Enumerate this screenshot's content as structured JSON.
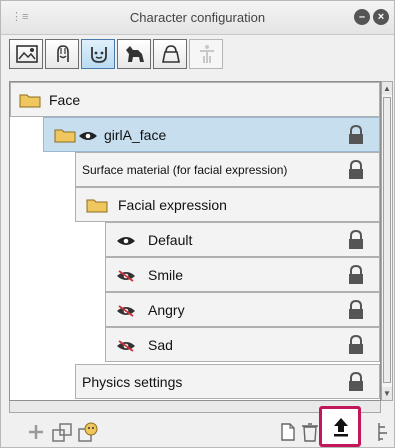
{
  "panel": {
    "title": "Character configuration",
    "title_icons": [
      "minimize-icon",
      "close-icon"
    ]
  },
  "tabs": [
    {
      "icon": "image-icon",
      "state": "normal"
    },
    {
      "icon": "hair-icon",
      "state": "normal"
    },
    {
      "icon": "face-icon",
      "state": "active"
    },
    {
      "icon": "animal-icon",
      "state": "normal"
    },
    {
      "icon": "bag-icon",
      "state": "normal"
    },
    {
      "icon": "figure-icon",
      "state": "disabled"
    }
  ],
  "tree": {
    "items": [
      {
        "label": "Face",
        "icon": "folder-icon",
        "selected": false
      },
      {
        "label": "girlA_face",
        "icon": "folder-icon",
        "visibility": "visible",
        "locked": true,
        "selected": true
      },
      {
        "label": "Surface material (for facial expression)",
        "locked": true,
        "selected": false
      },
      {
        "label": "Facial expression",
        "icon": "folder-icon",
        "selected": false
      },
      {
        "label": "Default",
        "visibility": "visible",
        "locked": true,
        "selected": false
      },
      {
        "label": "Smile",
        "visibility": "hidden",
        "locked": true,
        "selected": false
      },
      {
        "label": "Angry",
        "visibility": "hidden",
        "locked": true,
        "selected": false
      },
      {
        "label": "Sad",
        "visibility": "hidden",
        "locked": true,
        "selected": false
      },
      {
        "label": "Physics settings",
        "locked": true,
        "selected": false
      }
    ]
  },
  "bottom_toolbar": {
    "left_icons": [
      "add-icon",
      "add-set-icon",
      "add-expression-icon"
    ],
    "right_icons": [
      "new-page-icon",
      "trash-icon",
      "upload-icon",
      "settings-icon"
    ],
    "highlight_color": "#c2185b"
  },
  "colors": {
    "selected_row": "#c7deef",
    "folder": "#f0c75e",
    "lock": "#555555"
  }
}
